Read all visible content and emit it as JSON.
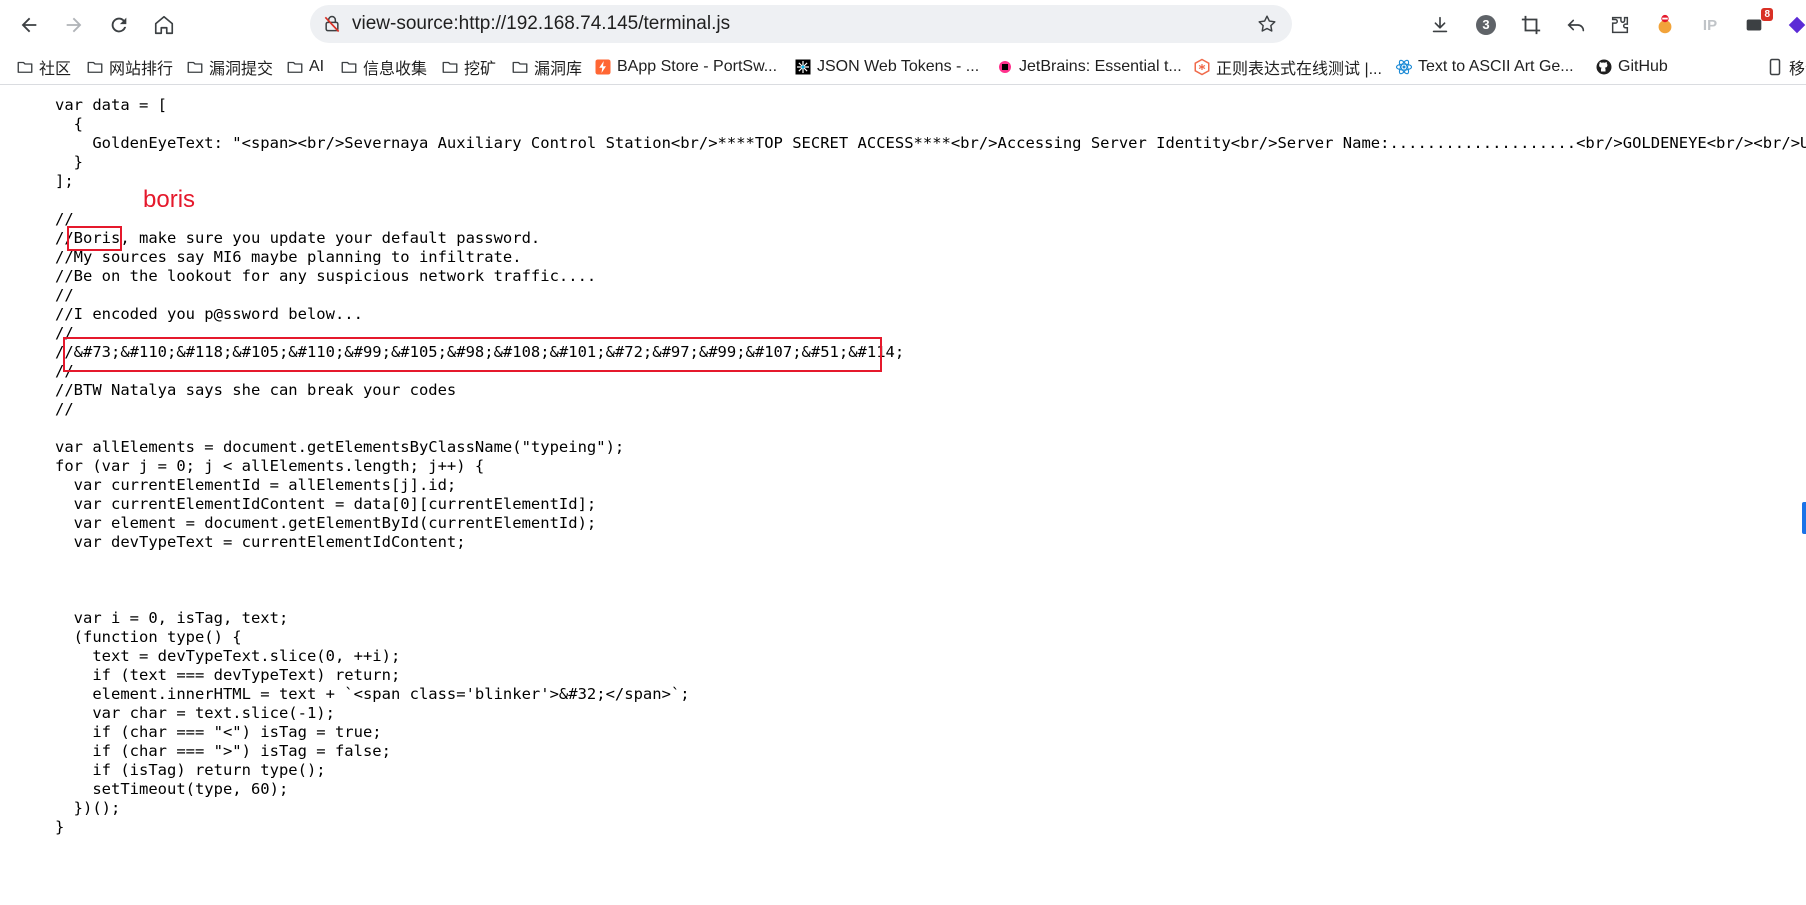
{
  "toolbar": {
    "url": "view-source:http://192.168.74.145/terminal.js",
    "ext_badge_count": "3",
    "ip_label": "IP",
    "notification_count": "8"
  },
  "bookmarks": [
    {
      "label": "社区",
      "icon": "folder-icon"
    },
    {
      "label": "网站排行",
      "icon": "folder-icon"
    },
    {
      "label": "漏洞提交",
      "icon": "folder-icon"
    },
    {
      "label": "AI",
      "icon": "folder-icon"
    },
    {
      "label": "信息收集",
      "icon": "folder-icon"
    },
    {
      "label": "挖矿",
      "icon": "folder-icon"
    },
    {
      "label": "漏洞库",
      "icon": "folder-icon"
    },
    {
      "label": "BApp Store - PortSw...",
      "icon": "portswigger-icon"
    },
    {
      "label": "JSON Web Tokens - ...",
      "icon": "jwt-icon"
    },
    {
      "label": "JetBrains: Essential t...",
      "icon": "jetbrains-icon"
    },
    {
      "label": "正则表达式在线测试 |...",
      "icon": "regex-icon"
    },
    {
      "label": "Text to ASCII Art Ge...",
      "icon": "react-icon"
    },
    {
      "label": "GitHub",
      "icon": "github-icon"
    },
    {
      "label": "移动",
      "icon": "mobile-icon"
    }
  ],
  "code_lines": [
    "var data = [",
    "  {",
    "    GoldenEyeText: \"<span><br/>Severnaya Auxiliary Control Station<br/>****TOP SECRET ACCESS****<br/>Accessing Server Identity<br/>Server Name:....................<br/>GOLDENEYE<br/><br/>User: UNK",
    "  }",
    "];",
    "",
    "//",
    "//Boris, make sure you update your default password.",
    "//My sources say MI6 maybe planning to infiltrate.",
    "//Be on the lookout for any suspicious network traffic....",
    "//",
    "//I encoded you p@ssword below...",
    "//",
    "//&#73;&#110;&#118;&#105;&#110;&#99;&#105;&#98;&#108;&#101;&#72;&#97;&#99;&#107;&#51;&#114;",
    "//",
    "//BTW Natalya says she can break your codes",
    "//",
    "",
    "var allElements = document.getElementsByClassName(\"typeing\");",
    "for (var j = 0; j < allElements.length; j++) {",
    "  var currentElementId = allElements[j].id;",
    "  var currentElementIdContent = data[0][currentElementId];",
    "  var element = document.getElementById(currentElementId);",
    "  var devTypeText = currentElementIdContent;",
    "",
    "",
    "",
    "  var i = 0, isTag, text;",
    "  (function type() {",
    "    text = devTypeText.slice(0, ++i);",
    "    if (text === devTypeText) return;",
    "    element.innerHTML = text + `<span class='blinker'>&#32;</span>`;",
    "    var char = text.slice(-1);",
    "    if (char === \"<\") isTag = true;",
    "    if (char === \">\") isTag = false;",
    "    if (isTag) return type();",
    "    setTimeout(type, 60);",
    "  })();",
    "}"
  ],
  "annotation": {
    "text": "boris",
    "color": "#e5192c"
  }
}
